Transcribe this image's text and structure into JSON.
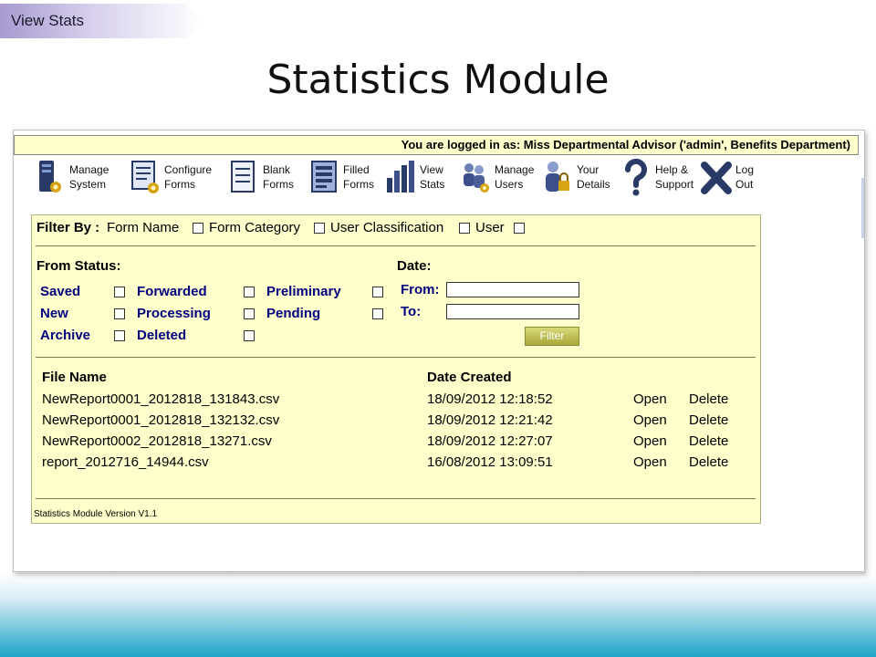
{
  "slide": {
    "breadcrumb": "View Stats",
    "title": "Statistics Module"
  },
  "app": {
    "login_text": "You are logged in as: Miss Departmental Advisor ('admin', Benefits Department)",
    "nav": [
      {
        "label": "Manage\nSystem",
        "icon": "manage-system-icon"
      },
      {
        "label": "Configure\nForms",
        "icon": "configure-forms-icon"
      },
      {
        "label": "Blank\nForms",
        "icon": "blank-forms-icon"
      },
      {
        "label": "Filled\nForms",
        "icon": "filled-forms-icon"
      },
      {
        "label": "View\nStats",
        "icon": "view-stats-icon"
      },
      {
        "label": "Manage\nUsers",
        "icon": "manage-users-icon"
      },
      {
        "label": "Your\nDetails",
        "icon": "your-details-icon"
      },
      {
        "label": "Help &\nSupport",
        "icon": "help-icon"
      },
      {
        "label": "Log\nOut",
        "icon": "logout-icon"
      }
    ],
    "filter_by": {
      "label": "Filter By :",
      "options": [
        "Form Name",
        "Form Category",
        "User Classification",
        "User"
      ]
    },
    "status": {
      "label": "From Status:",
      "col1": [
        "Saved",
        "New",
        "Archive"
      ],
      "col2": [
        "Forwarded",
        "Processing",
        "Deleted"
      ],
      "col3": [
        "Preliminary",
        "Pending"
      ]
    },
    "date": {
      "label": "Date:",
      "from_label": "From:",
      "to_label": "To:",
      "from_value": "",
      "to_value": ""
    },
    "filter_button": "Filter",
    "files": {
      "headers": [
        "File Name",
        "Date Created"
      ],
      "open_label": "Open",
      "delete_label": "Delete",
      "rows": [
        {
          "name": "NewReport0001_2012818_131843.csv",
          "date": "18/09/2012 12:18:52"
        },
        {
          "name": "NewReport0001_2012818_132132.csv",
          "date": "18/09/2012 12:21:42"
        },
        {
          "name": "NewReport0002_2012818_13271.csv",
          "date": "18/09/2012 12:27:07"
        },
        {
          "name": "report_2012716_14944.csv",
          "date": "16/08/2012 13:09:51"
        }
      ]
    },
    "version": "Statistics Module Version V1.1"
  },
  "colors": {
    "panel_bg": "#ffffcc",
    "status_text": "#000080",
    "filter_button": "#b5b548"
  }
}
